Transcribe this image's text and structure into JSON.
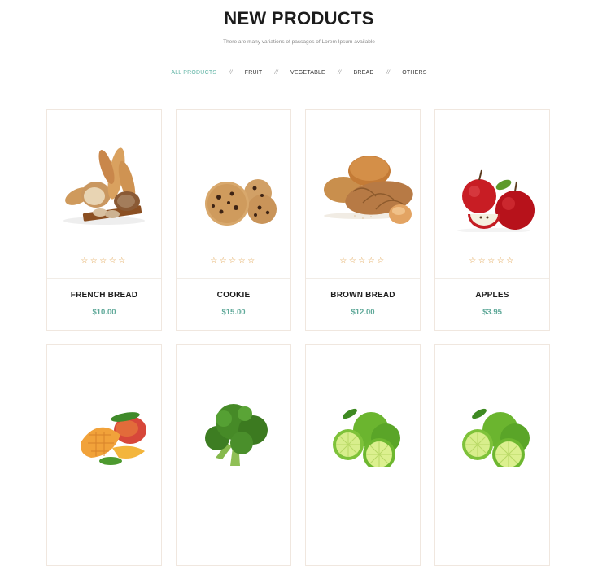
{
  "header": {
    "title": "NEW PRODUCTS",
    "subtitle": "There are many variations of passages of Lorem Ipsum available"
  },
  "filters": [
    {
      "label": "ALL PRODUCTS",
      "active": true
    },
    {
      "label": "FRUIT",
      "active": false
    },
    {
      "label": "VEGETABLE",
      "active": false
    },
    {
      "label": "BREAD",
      "active": false
    },
    {
      "label": "OTHERS",
      "active": false
    }
  ],
  "filter_separator": "//",
  "products": [
    {
      "name": "FRENCH BREAD",
      "price": "$10.00",
      "rating": "☆☆☆☆☆",
      "image": "french-bread-image"
    },
    {
      "name": "COOKIE",
      "price": "$15.00",
      "rating": "☆☆☆☆☆",
      "image": "cookie-image"
    },
    {
      "name": "BROWN BREAD",
      "price": "$12.00",
      "rating": "☆☆☆☆☆",
      "image": "brown-bread-image"
    },
    {
      "name": "APPLES",
      "price": "$3.95",
      "rating": "☆☆☆☆☆",
      "image": "apples-image"
    },
    {
      "name": "",
      "price": "",
      "rating": "",
      "image": "mango-image"
    },
    {
      "name": "",
      "price": "",
      "rating": "",
      "image": "broccoli-image"
    },
    {
      "name": "",
      "price": "",
      "rating": "",
      "image": "lime-image"
    },
    {
      "name": "",
      "price": "",
      "rating": "",
      "image": "lime-image"
    }
  ],
  "colors": {
    "accent": "#62b5a6",
    "price": "#5fa999",
    "star": "#e0a04b",
    "card_border": "#f0e7df"
  }
}
